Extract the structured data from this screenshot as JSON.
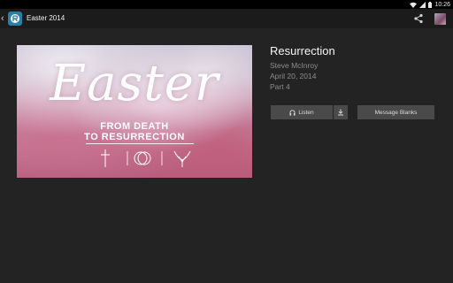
{
  "status_bar": {
    "time": "10:26"
  },
  "action_bar": {
    "title": "Easter 2014",
    "icons": [
      "back-chevron-icon",
      "app-logo-icon",
      "share-icon",
      "avatar"
    ]
  },
  "cover": {
    "title": "Easter",
    "subtitle_line1": "FROM DEATH",
    "subtitle_line2": "TO RESURRECTION",
    "symbols": [
      "cross-icon",
      "tomb-icon",
      "rising-dove-icon"
    ]
  },
  "sermon": {
    "title": "Resurrection",
    "speaker": "Steve McInroy",
    "date": "April 20, 2014",
    "part": "Part 4"
  },
  "buttons": {
    "listen_label": "Listen",
    "message_blanks_label": "Message Blanks"
  },
  "colors": {
    "background": "#232323",
    "action_bar": "#1b1b1b",
    "button": "#4a4a4a",
    "app_logo": "#2a7fa6",
    "meta_text": "#8d8d8d"
  }
}
